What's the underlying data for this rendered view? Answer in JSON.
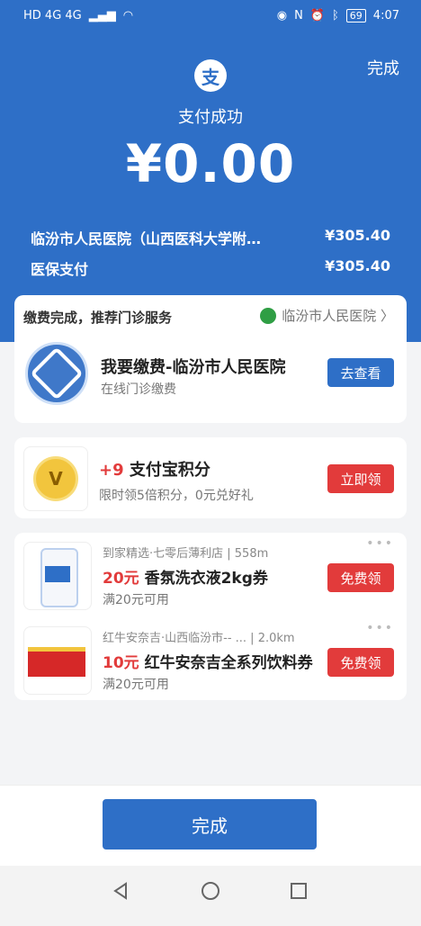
{
  "status_bar": {
    "left_text": "HD 4G 4G",
    "battery": "69",
    "time": "4:07"
  },
  "header": {
    "done_label": "完成",
    "logo_char": "支",
    "title": "支付成功",
    "amount": "¥0.00"
  },
  "details": [
    {
      "label": "临汾市人民医院（山西医科大学附…",
      "value": "¥305.40"
    },
    {
      "label": "医保支付",
      "value": "¥305.40"
    }
  ],
  "hospital_card": {
    "header": "缴费完成，推荐门诊服务",
    "hospital_link": "临汾市人民医院 〉",
    "title": "我要缴费-临汾市人民医院",
    "subtitle": "在线门诊缴费",
    "button": "去查看"
  },
  "points_card": {
    "plus": "+9",
    "title": "支付宝积分",
    "subtitle": "限时领5倍积分，0元兑好礼",
    "button": "立即领",
    "coin_char": "V"
  },
  "coupons": [
    {
      "store": "到家精选·七零后薄利店 | 558m",
      "amount": "20元",
      "name": "香氛洗衣液2kg券",
      "condition": "满20元可用",
      "button": "免费领"
    },
    {
      "store": "红牛安奈吉·山西临汾市-- ... | 2.0km",
      "amount": "10元",
      "name": "红牛安奈吉全系列饮料券",
      "condition": "满20元可用",
      "button": "免费领"
    }
  ],
  "footer": {
    "done_button": "完成"
  },
  "colors": {
    "primary": "#2e6fc7",
    "accent_red": "#e23b3b"
  },
  "icons": [
    "signal-icon",
    "wifi-icon",
    "eye-icon",
    "nfc-icon",
    "alarm-icon",
    "bluetooth-icon",
    "battery-icon",
    "back-nav-icon",
    "home-nav-icon",
    "recents-nav-icon"
  ]
}
